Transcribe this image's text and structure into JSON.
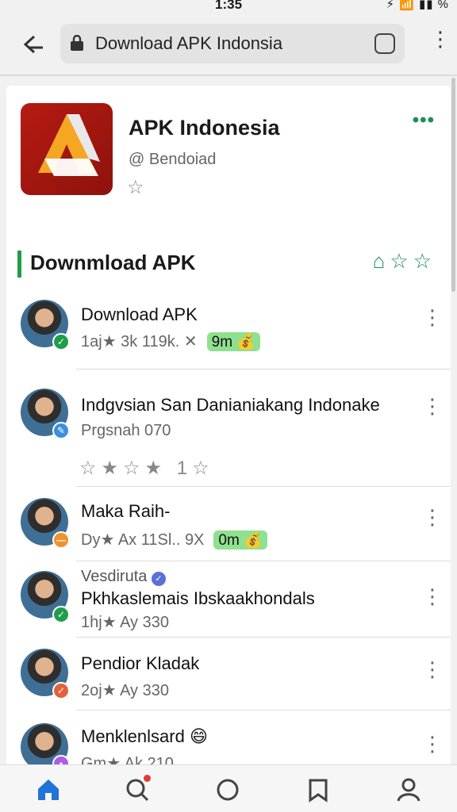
{
  "status_bar": {
    "time": "1:35",
    "icons_text": "⚡ 📶 ▮▮ %"
  },
  "browser": {
    "url": "Download APK Indonsia"
  },
  "app": {
    "title": "APK Indonesia",
    "handle": "@ Bendoiad",
    "accent": "#1e8e5a"
  },
  "section": {
    "title": "Downmload APK"
  },
  "items": [
    {
      "name": "Download APK",
      "meta": "1aj★ 3k   119k.  ✕",
      "pill": "9m 💰",
      "badge_color": "#1e9e4a"
    },
    {
      "name": "Indgvsian San Danianiakang Indonake",
      "meta": "Prgsnah   070",
      "badge_color": "#3a8fe0"
    },
    {
      "name": "Maka Raih-",
      "meta": "Dy★ Ax   11Sl..  9X",
      "pill": "0m 💰",
      "badge_color": "#f0922d"
    },
    {
      "pre": "Vesdiruta",
      "name": "Pkhkaslemais Ibskaakhondals",
      "meta": "1hj★ Ay   330",
      "badge_color": "#1e9e4a"
    },
    {
      "name": "Pendior Kladak",
      "meta": "2oj★ Ay   330",
      "badge_color": "#e2623a"
    },
    {
      "name": "Menklenlsard 😄",
      "meta": "Gm★ Ak   210",
      "badge_color": "#b05ce6"
    }
  ],
  "row2_stars": "☆★☆★ 1☆",
  "bottom_nav": [
    "home-icon",
    "search-icon",
    "circle-icon",
    "bookmark-icon",
    "profile-icon"
  ]
}
